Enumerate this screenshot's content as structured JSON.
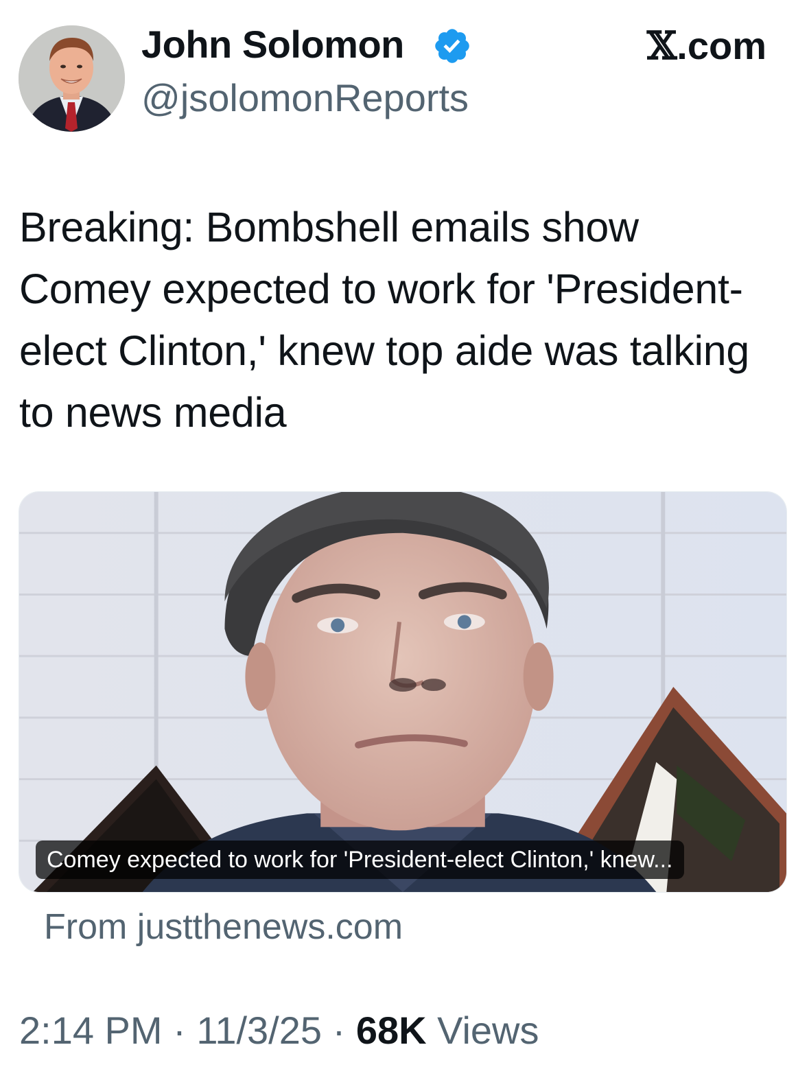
{
  "author": {
    "display_name": "John Solomon",
    "handle": "@jsolomonReports",
    "verified": true,
    "verified_color": "#1d9bf0"
  },
  "brand": {
    "logo": "𝕏",
    "suffix": ".com"
  },
  "tweet": {
    "text": "Breaking: Bombshell emails show Comey expected to work for 'President-elect Clinton,' knew top aide was talking to news media"
  },
  "link_card": {
    "caption": "Comey expected to work for 'President-elect Clinton,' knew...",
    "source": "From justthenews.com"
  },
  "meta": {
    "time": "2:14 PM",
    "separator": "·",
    "date": "11/3/25",
    "views_count": "68K",
    "views_label": "Views"
  },
  "colors": {
    "text_primary": "#0f1419",
    "text_secondary": "#536471"
  }
}
